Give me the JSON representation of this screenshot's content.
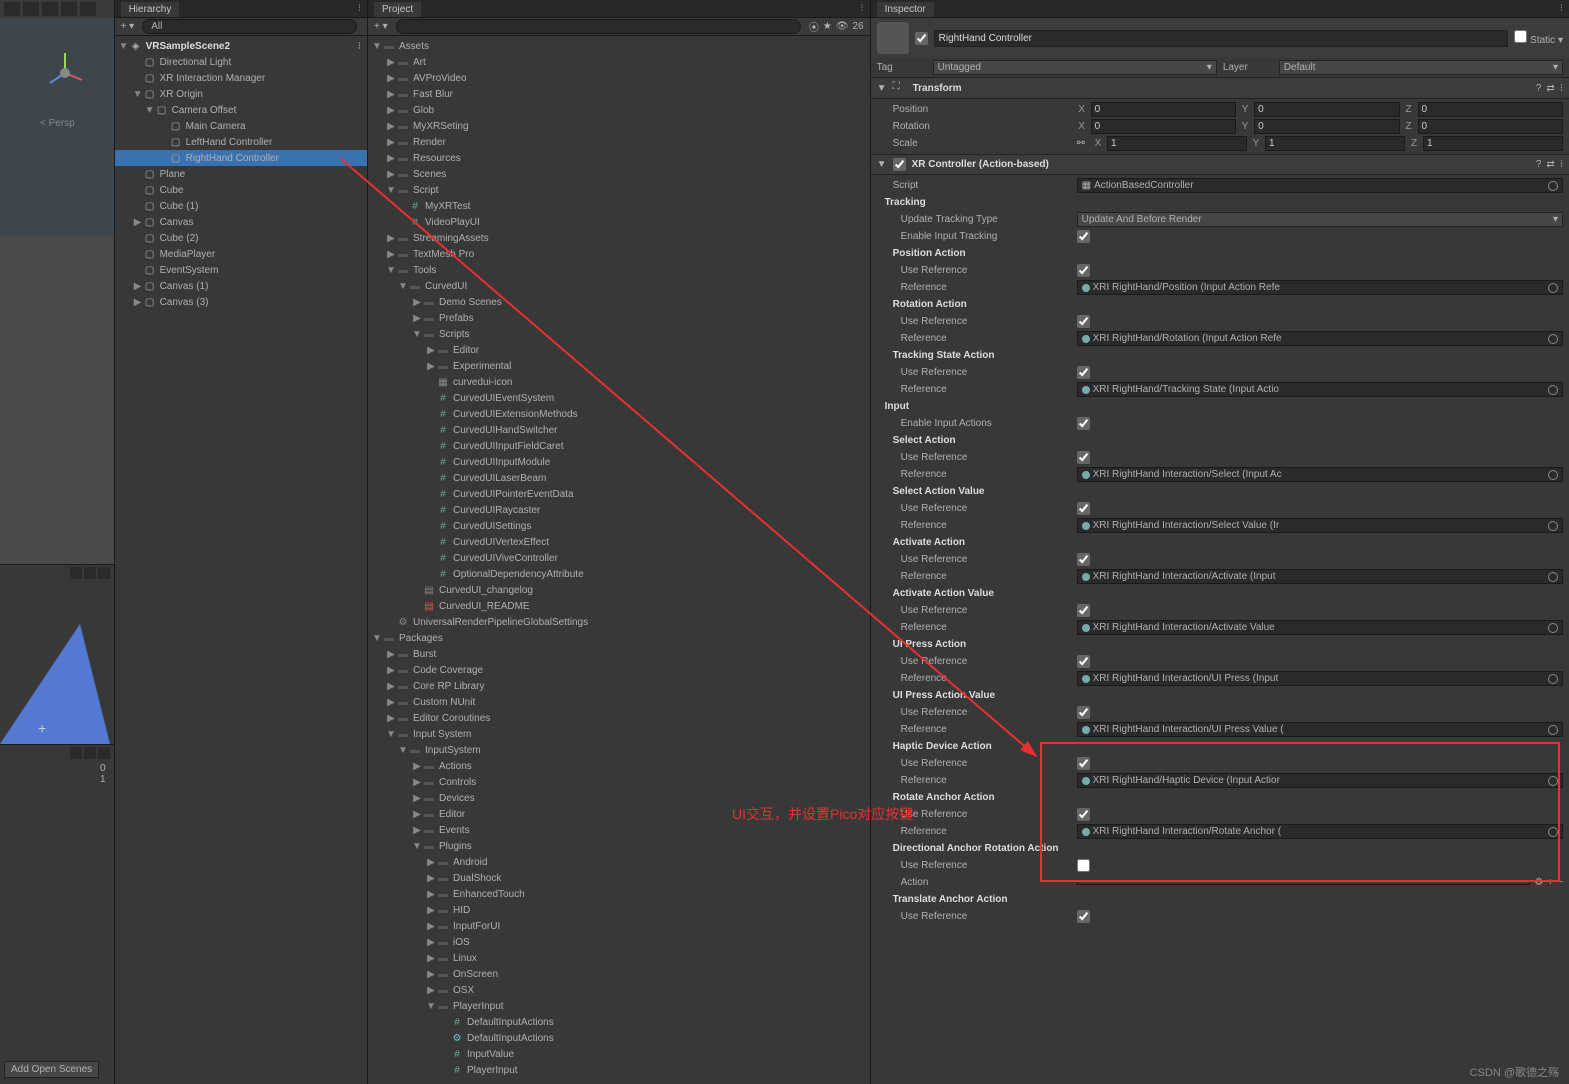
{
  "panels": {
    "hierarchy": "Hierarchy",
    "project": "Project",
    "inspector": "Inspector"
  },
  "scene": {
    "persp": "< Persp",
    "open_scenes": "Add Open Scenes",
    "stats": [
      "0",
      "1"
    ]
  },
  "hierarchy": {
    "scene": "VRSampleScene2",
    "items": [
      {
        "t": "Directional Light",
        "i": 1
      },
      {
        "t": "XR Interaction Manager",
        "i": 1
      },
      {
        "t": "XR Origin",
        "i": 1,
        "a": "▼"
      },
      {
        "t": "Camera Offset",
        "i": 2,
        "a": "▼"
      },
      {
        "t": "Main Camera",
        "i": 3
      },
      {
        "t": "LeftHand Controller",
        "i": 3
      },
      {
        "t": "RightHand Controller",
        "i": 3,
        "sel": true
      },
      {
        "t": "Plane",
        "i": 1
      },
      {
        "t": "Cube",
        "i": 1
      },
      {
        "t": "Cube (1)",
        "i": 1
      },
      {
        "t": "Canvas",
        "i": 1,
        "a": "▶"
      },
      {
        "t": "Cube (2)",
        "i": 1
      },
      {
        "t": "MediaPlayer",
        "i": 1
      },
      {
        "t": "EventSystem",
        "i": 1
      },
      {
        "t": "Canvas (1)",
        "i": 1,
        "a": "▶"
      },
      {
        "t": "Canvas (3)",
        "i": 1,
        "a": "▶"
      }
    ]
  },
  "project": {
    "search_ph": "",
    "count": "26",
    "tree": [
      {
        "t": "Assets",
        "i": 0,
        "a": "▼",
        "f": true
      },
      {
        "t": "Art",
        "i": 1,
        "a": "▶",
        "f": true
      },
      {
        "t": "AVProVideo",
        "i": 1,
        "a": "▶",
        "f": true
      },
      {
        "t": "Fast Blur",
        "i": 1,
        "a": "▶",
        "f": true
      },
      {
        "t": "Glob",
        "i": 1,
        "a": "▶",
        "f": true
      },
      {
        "t": "MyXRSeting",
        "i": 1,
        "a": "▶",
        "f": true
      },
      {
        "t": "Render",
        "i": 1,
        "a": "▶",
        "f": true
      },
      {
        "t": "Resources",
        "i": 1,
        "a": "▶",
        "f": true
      },
      {
        "t": "Scenes",
        "i": 1,
        "a": "▶",
        "f": true
      },
      {
        "t": "Script",
        "i": 1,
        "a": "▼",
        "f": true
      },
      {
        "t": "MyXRTest",
        "i": 2,
        "cs": true
      },
      {
        "t": "VideoPlayUI",
        "i": 2,
        "cs": true
      },
      {
        "t": "StreamingAssets",
        "i": 1,
        "a": "▶",
        "f": true
      },
      {
        "t": "TextMesh Pro",
        "i": 1,
        "a": "▶",
        "f": true
      },
      {
        "t": "Tools",
        "i": 1,
        "a": "▼",
        "f": true
      },
      {
        "t": "CurvedUI",
        "i": 2,
        "a": "▼",
        "f": true
      },
      {
        "t": "Demo Scenes",
        "i": 3,
        "a": "▶",
        "f": true
      },
      {
        "t": "Prefabs",
        "i": 3,
        "a": "▶",
        "f": true
      },
      {
        "t": "Scripts",
        "i": 3,
        "a": "▼",
        "f": true
      },
      {
        "t": "Editor",
        "i": 4,
        "a": "▶",
        "f": true
      },
      {
        "t": "Experimental",
        "i": 4,
        "a": "▶",
        "f": true
      },
      {
        "t": "curvedui-icon",
        "i": 4,
        "img": true
      },
      {
        "t": "CurvedUIEventSystem",
        "i": 4,
        "cs": true
      },
      {
        "t": "CurvedUIExtensionMethods",
        "i": 4,
        "cs": true
      },
      {
        "t": "CurvedUIHandSwitcher",
        "i": 4,
        "cs": true
      },
      {
        "t": "CurvedUIInputFieldCaret",
        "i": 4,
        "cs": true
      },
      {
        "t": "CurvedUIInputModule",
        "i": 4,
        "cs": true
      },
      {
        "t": "CurvedUILaserBeam",
        "i": 4,
        "cs": true
      },
      {
        "t": "CurvedUIPointerEventData",
        "i": 4,
        "cs": true
      },
      {
        "t": "CurvedUIRaycaster",
        "i": 4,
        "cs": true
      },
      {
        "t": "CurvedUISettings",
        "i": 4,
        "cs": true
      },
      {
        "t": "CurvedUIVertexEffect",
        "i": 4,
        "cs": true
      },
      {
        "t": "CurvedUIViveController",
        "i": 4,
        "cs": true
      },
      {
        "t": "OptionalDependencyAttribute",
        "i": 4,
        "cs": true
      },
      {
        "t": "CurvedUI_changelog",
        "i": 3,
        "txt": true
      },
      {
        "t": "CurvedUI_README",
        "i": 3,
        "pdf": true
      },
      {
        "t": "UniversalRenderPipelineGlobalSettings",
        "i": 1,
        "cfg": true
      },
      {
        "t": "Packages",
        "i": 0,
        "a": "▼",
        "f": true
      },
      {
        "t": "Burst",
        "i": 1,
        "a": "▶",
        "f": true
      },
      {
        "t": "Code Coverage",
        "i": 1,
        "a": "▶",
        "f": true
      },
      {
        "t": "Core RP Library",
        "i": 1,
        "a": "▶",
        "f": true
      },
      {
        "t": "Custom NUnit",
        "i": 1,
        "a": "▶",
        "f": true
      },
      {
        "t": "Editor Coroutines",
        "i": 1,
        "a": "▶",
        "f": true
      },
      {
        "t": "Input System",
        "i": 1,
        "a": "▼",
        "f": true
      },
      {
        "t": "InputSystem",
        "i": 2,
        "a": "▼",
        "f": true
      },
      {
        "t": "Actions",
        "i": 3,
        "a": "▶",
        "f": true
      },
      {
        "t": "Controls",
        "i": 3,
        "a": "▶",
        "f": true
      },
      {
        "t": "Devices",
        "i": 3,
        "a": "▶",
        "f": true
      },
      {
        "t": "Editor",
        "i": 3,
        "a": "▶",
        "f": true
      },
      {
        "t": "Events",
        "i": 3,
        "a": "▶",
        "f": true
      },
      {
        "t": "Plugins",
        "i": 3,
        "a": "▼",
        "f": true
      },
      {
        "t": "Android",
        "i": 4,
        "a": "▶",
        "f": true
      },
      {
        "t": "DualShock",
        "i": 4,
        "a": "▶",
        "f": true
      },
      {
        "t": "EnhancedTouch",
        "i": 4,
        "a": "▶",
        "f": true
      },
      {
        "t": "HID",
        "i": 4,
        "a": "▶",
        "f": true
      },
      {
        "t": "InputForUI",
        "i": 4,
        "a": "▶",
        "f": true
      },
      {
        "t": "iOS",
        "i": 4,
        "a": "▶",
        "f": true
      },
      {
        "t": "Linux",
        "i": 4,
        "a": "▶",
        "f": true
      },
      {
        "t": "OnScreen",
        "i": 4,
        "a": "▶",
        "f": true
      },
      {
        "t": "OSX",
        "i": 4,
        "a": "▶",
        "f": true
      },
      {
        "t": "PlayerInput",
        "i": 4,
        "a": "▼",
        "f": true
      },
      {
        "t": "DefaultInputActions",
        "i": 5,
        "cs": true
      },
      {
        "t": "DefaultInputActions",
        "i": 5,
        "act": true
      },
      {
        "t": "InputValue",
        "i": 5,
        "cs": true
      },
      {
        "t": "PlayerInput",
        "i": 5,
        "cs": true
      }
    ]
  },
  "inspector": {
    "name": "RightHand Controller",
    "static": "Static",
    "tag_lbl": "Tag",
    "tag": "Untagged",
    "layer_lbl": "Layer",
    "layer": "Default",
    "transform": {
      "title": "Transform",
      "pos": {
        "l": "Position",
        "x": "0",
        "y": "0",
        "z": "0"
      },
      "rot": {
        "l": "Rotation",
        "x": "0",
        "y": "0",
        "z": "0"
      },
      "scl": {
        "l": "Scale",
        "x": "1",
        "y": "1",
        "z": "1"
      }
    },
    "xr": {
      "title": "XR Controller (Action-based)",
      "script_lbl": "Script",
      "script": "ActionBasedController"
    },
    "sections": [
      {
        "h": "Tracking",
        "rows": [
          {
            "l": "Update Tracking Type",
            "dd": "Update And Before Render"
          },
          {
            "l": "Enable Input Tracking",
            "cb": true
          }
        ]
      },
      {
        "h2": "Position Action",
        "rows": [
          {
            "l": "Use Reference",
            "cb": true
          },
          {
            "l": "Reference",
            "ref": "XRI RightHand/Position (Input Action Refe"
          }
        ]
      },
      {
        "h2": "Rotation Action",
        "rows": [
          {
            "l": "Use Reference",
            "cb": true
          },
          {
            "l": "Reference",
            "ref": "XRI RightHand/Rotation (Input Action Refe"
          }
        ]
      },
      {
        "h2": "Tracking State Action",
        "rows": [
          {
            "l": "Use Reference",
            "cb": true
          },
          {
            "l": "Reference",
            "ref": "XRI RightHand/Tracking State (Input Actio"
          }
        ]
      },
      {
        "h": "Input",
        "rows": [
          {
            "l": "Enable Input Actions",
            "cb": true
          }
        ]
      },
      {
        "h2": "Select Action",
        "rows": [
          {
            "l": "Use Reference",
            "cb": true
          },
          {
            "l": "Reference",
            "ref": "XRI RightHand Interaction/Select (Input Ac"
          }
        ]
      },
      {
        "h2": "Select Action Value",
        "rows": [
          {
            "l": "Use Reference",
            "cb": true
          },
          {
            "l": "Reference",
            "ref": "XRI RightHand Interaction/Select Value (Ir"
          }
        ]
      },
      {
        "h2": "Activate Action",
        "rows": [
          {
            "l": "Use Reference",
            "cb": true
          },
          {
            "l": "Reference",
            "ref": "XRI RightHand Interaction/Activate (Input"
          }
        ]
      },
      {
        "h2": "Activate Action Value",
        "rows": [
          {
            "l": "Use Reference",
            "cb": true
          },
          {
            "l": "Reference",
            "ref": "XRI RightHand Interaction/Activate Value"
          }
        ]
      },
      {
        "h2": "UI Press Action",
        "rows": [
          {
            "l": "Use Reference",
            "cb": true
          },
          {
            "l": "Reference",
            "ref": "XRI RightHand Interaction/UI Press (Input"
          }
        ]
      },
      {
        "h2": "UI Press Action Value",
        "rows": [
          {
            "l": "Use Reference",
            "cb": true
          },
          {
            "l": "Reference",
            "ref": "XRI RightHand Interaction/UI Press Value ("
          }
        ]
      },
      {
        "h2": "Haptic Device Action",
        "rows": [
          {
            "l": "Use Reference",
            "cb": true
          },
          {
            "l": "Reference",
            "ref": "XRI RightHand/Haptic Device (Input Actior"
          }
        ]
      },
      {
        "h2": "Rotate Anchor Action",
        "rows": [
          {
            "l": "Use Reference",
            "cb": true
          },
          {
            "l": "Reference",
            "ref": "XRI RightHand Interaction/Rotate Anchor ("
          }
        ]
      },
      {
        "h2": "Directional Anchor Rotation Action",
        "rows": [
          {
            "l": "Use Reference",
            "cb": false
          },
          {
            "l": "Action",
            "action": true
          }
        ]
      },
      {
        "h2": "Translate Anchor Action",
        "rows": [
          {
            "l": "Use Reference",
            "cb": true
          }
        ]
      }
    ]
  },
  "annotation": {
    "text": "UI交互，并设置Pico对应按键",
    "watermark": "CSDN @歌德之殇"
  }
}
